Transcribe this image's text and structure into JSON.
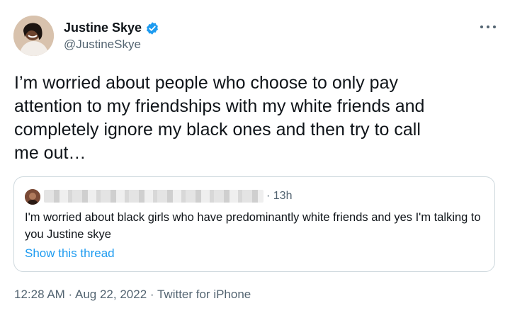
{
  "author": {
    "display_name": "Justine Skye",
    "handle": "@JustineSkye",
    "verified_icon": "verified-badge-icon",
    "avatar_icon": "profile-photo"
  },
  "tweet": {
    "text": "I’m worried about people who choose to only pay\nattention to my friendships with my white friends and\ncompletely ignore my black ones and then try to call\nme out…"
  },
  "quote": {
    "time": "· 13h",
    "text": "I'm worried about black girls who have predominantly white friends and yes I'm talking to you Justine skye",
    "link": "Show this thread"
  },
  "meta": {
    "time": "12:28 AM",
    "sep1": " · ",
    "date": "Aug 22, 2022",
    "sep2": " · ",
    "source": "Twitter for iPhone"
  },
  "colors": {
    "accent": "#1d9bf0",
    "secondary_text": "#536471",
    "border": "#cfd9de"
  }
}
